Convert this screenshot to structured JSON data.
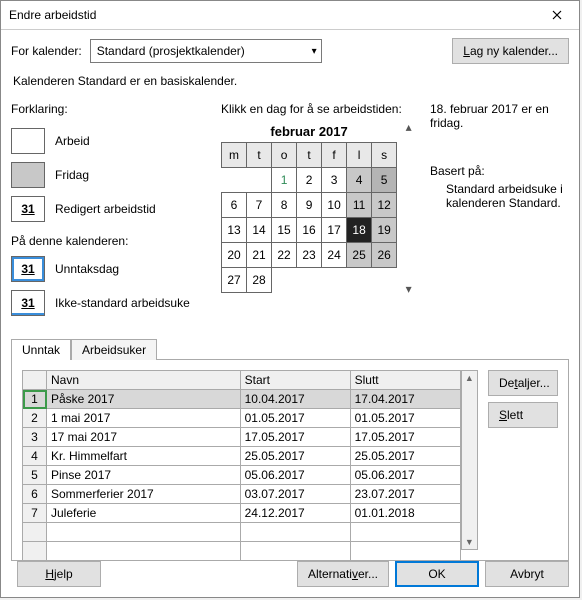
{
  "title": "Endre arbeidstid",
  "for_kalender_label": "For kalender:",
  "selected_calendar": "Standard (prosjektkalender)",
  "new_calendar_btn": {
    "u": "L",
    "rest": "ag ny kalender..."
  },
  "basis_note": "Kalenderen Standard er en basiskalender.",
  "legend": {
    "heading": "Forklaring:",
    "arbeid": "Arbeid",
    "fridag": "Fridag",
    "redigert": "Redigert arbeidstid",
    "sub": "På denne kalenderen:",
    "unntaksdag": "Unntaksdag",
    "ikkestd": "Ikke-standard arbeidsuke",
    "box_num": "31"
  },
  "cal": {
    "instruct": "Klikk en dag for å se arbeidstiden:",
    "month": "februar 2017",
    "dow": [
      "m",
      "t",
      "o",
      "t",
      "f",
      "l",
      "s"
    ],
    "weeks": [
      [
        {
          "v": ""
        },
        {
          "v": ""
        },
        {
          "v": "1",
          "green": true
        },
        {
          "v": "2"
        },
        {
          "v": "3"
        },
        {
          "v": "4",
          "gray": true
        },
        {
          "v": "5",
          "gray2": true
        }
      ],
      [
        {
          "v": "6"
        },
        {
          "v": "7"
        },
        {
          "v": "8"
        },
        {
          "v": "9"
        },
        {
          "v": "10"
        },
        {
          "v": "11",
          "gray": true
        },
        {
          "v": "12",
          "gray": true
        }
      ],
      [
        {
          "v": "13"
        },
        {
          "v": "14"
        },
        {
          "v": "15"
        },
        {
          "v": "16"
        },
        {
          "v": "17"
        },
        {
          "v": "18",
          "sel": true
        },
        {
          "v": "19",
          "gray": true
        }
      ],
      [
        {
          "v": "20"
        },
        {
          "v": "21"
        },
        {
          "v": "22"
        },
        {
          "v": "23"
        },
        {
          "v": "24"
        },
        {
          "v": "25",
          "gray": true
        },
        {
          "v": "26",
          "gray": true
        }
      ],
      [
        {
          "v": "27"
        },
        {
          "v": "28"
        },
        {
          "v": ""
        },
        {
          "v": ""
        },
        {
          "v": ""
        },
        {
          "v": ""
        },
        {
          "v": ""
        }
      ],
      [
        {
          "v": ""
        },
        {
          "v": ""
        },
        {
          "v": ""
        },
        {
          "v": ""
        },
        {
          "v": ""
        },
        {
          "v": ""
        },
        {
          "v": ""
        }
      ]
    ]
  },
  "right": {
    "sel_day": "18. februar 2017 er en fridag.",
    "basert_label": "Basert på:",
    "basert_text": "Standard arbeidsuke i kalenderen Standard."
  },
  "tabs": {
    "unntak": "Unntak",
    "arbeidsuker": "Arbeidsuker"
  },
  "grid": {
    "cols": {
      "navn": "Navn",
      "start": "Start",
      "slutt": "Slutt"
    },
    "rows": [
      {
        "n": "1",
        "navn": "Påske 2017",
        "start": "10.04.2017",
        "slutt": "17.04.2017",
        "sel": true
      },
      {
        "n": "2",
        "navn": "1 mai 2017",
        "start": "01.05.2017",
        "slutt": "01.05.2017"
      },
      {
        "n": "3",
        "navn": "17 mai 2017",
        "start": "17.05.2017",
        "slutt": "17.05.2017"
      },
      {
        "n": "4",
        "navn": "Kr. Himmelfart",
        "start": "25.05.2017",
        "slutt": "25.05.2017"
      },
      {
        "n": "5",
        "navn": "Pinse 2017",
        "start": "05.06.2017",
        "slutt": "05.06.2017"
      },
      {
        "n": "6",
        "navn": "Sommerferier 2017",
        "start": "03.07.2017",
        "slutt": "23.07.2017"
      },
      {
        "n": "7",
        "navn": "Juleferie",
        "start": "24.12.2017",
        "slutt": "01.01.2018"
      },
      {
        "n": "",
        "navn": "",
        "start": "",
        "slutt": ""
      },
      {
        "n": "",
        "navn": "",
        "start": "",
        "slutt": ""
      }
    ]
  },
  "side_btns": {
    "detaljer": {
      "pre": "De",
      "u": "t",
      "post": "aljer..."
    },
    "slett": {
      "u": "S",
      "post": "lett"
    }
  },
  "footer": {
    "hjelp": {
      "u": "H",
      "post": "jelp"
    },
    "alt": {
      "pre": "Alternati",
      "u": "v",
      "post": "er..."
    },
    "ok": "OK",
    "avbryt": "Avbryt"
  }
}
